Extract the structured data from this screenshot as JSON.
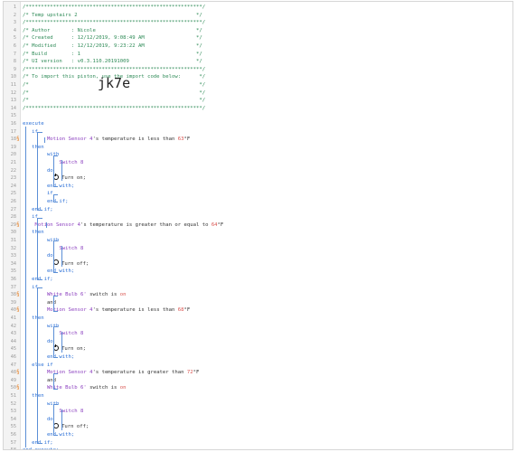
{
  "lines": [
    {
      "n": "1",
      "parts": [
        {
          "t": "/**********************************************************/",
          "c": "cm"
        }
      ]
    },
    {
      "n": "2",
      "parts": [
        {
          "t": "/* Temp upstairs 2                                       */",
          "c": "cm"
        }
      ]
    },
    {
      "n": "3",
      "parts": [
        {
          "t": "/**********************************************************/",
          "c": "cm"
        }
      ]
    },
    {
      "n": "4",
      "parts": [
        {
          "t": "/* Author       : Nicole                                 */",
          "c": "cm"
        }
      ]
    },
    {
      "n": "5",
      "parts": [
        {
          "t": "/* Created      : 12/12/2019, 9:08:49 AM                 */",
          "c": "cm"
        }
      ]
    },
    {
      "n": "6",
      "parts": [
        {
          "t": "/* Modified     : 12/12/2019, 9:23:22 AM                 */",
          "c": "cm"
        }
      ]
    },
    {
      "n": "7",
      "parts": [
        {
          "t": "/* Build        : 1                                      */",
          "c": "cm"
        }
      ]
    },
    {
      "n": "8",
      "parts": [
        {
          "t": "/* UI version   : v0.3.110.20191009                      */",
          "c": "cm"
        }
      ]
    },
    {
      "n": "9",
      "parts": [
        {
          "t": "/**********************************************************/",
          "c": "cm"
        }
      ]
    },
    {
      "n": "10",
      "parts": [
        {
          "t": "/* To import this piston, use the import code below:      */",
          "c": "cm"
        }
      ]
    },
    {
      "n": "11",
      "parts": [
        {
          "t": "/*                                                        */",
          "c": "cm"
        }
      ]
    },
    {
      "n": "12",
      "parts": [
        {
          "t": "/*                                                        */",
          "c": "cm"
        }
      ]
    },
    {
      "n": "13",
      "parts": [
        {
          "t": "/*                                                        */",
          "c": "cm"
        }
      ]
    },
    {
      "n": "14",
      "parts": [
        {
          "t": "/**********************************************************/",
          "c": "cm"
        }
      ]
    },
    {
      "n": "15",
      "parts": []
    },
    {
      "n": "16",
      "parts": [
        {
          "t": "execute",
          "c": "kw"
        }
      ]
    },
    {
      "n": "17",
      "parts": [
        {
          "t": "   if",
          "c": "kw"
        }
      ]
    },
    {
      "n": "18",
      "mark": true,
      "parts": [
        {
          "t": "        Motion Sensor 4",
          "c": "dev"
        },
        {
          "t": "'s temperature is less than ",
          "c": "txt"
        },
        {
          "t": "63",
          "c": "val"
        },
        {
          "t": "°F",
          "c": "txt"
        }
      ]
    },
    {
      "n": "19",
      "parts": [
        {
          "t": "   then",
          "c": "kw"
        }
      ]
    },
    {
      "n": "20",
      "parts": [
        {
          "t": "        with",
          "c": "kw"
        }
      ]
    },
    {
      "n": "21",
      "parts": [
        {
          "t": "            Switch 8",
          "c": "dev"
        }
      ]
    },
    {
      "n": "22",
      "parts": [
        {
          "t": "        do",
          "c": "kw"
        }
      ]
    },
    {
      "n": "23",
      "icon": "on",
      "parts": [
        {
          "t": "            Turn on;",
          "c": "txt"
        }
      ]
    },
    {
      "n": "24",
      "parts": [
        {
          "t": "        end with;",
          "c": "kw"
        }
      ]
    },
    {
      "n": "25",
      "parts": [
        {
          "t": "        if",
          "c": "kw"
        }
      ]
    },
    {
      "n": "26",
      "parts": [
        {
          "t": "        end if;",
          "c": "kw"
        }
      ]
    },
    {
      "n": "27",
      "parts": [
        {
          "t": "   end if;",
          "c": "kw"
        }
      ]
    },
    {
      "n": "28",
      "parts": [
        {
          "t": "   if",
          "c": "kw"
        }
      ]
    },
    {
      "n": "29",
      "mark": true,
      "parts": [
        {
          "t": "    Motion Sensor 4",
          "c": "dev"
        },
        {
          "t": "'s temperature is greater than or equal to ",
          "c": "txt"
        },
        {
          "t": "64",
          "c": "val"
        },
        {
          "t": "°F",
          "c": "txt"
        }
      ]
    },
    {
      "n": "30",
      "parts": [
        {
          "t": "   then",
          "c": "kw"
        }
      ]
    },
    {
      "n": "31",
      "parts": [
        {
          "t": "        with",
          "c": "kw"
        }
      ]
    },
    {
      "n": "32",
      "parts": [
        {
          "t": "            Switch 8",
          "c": "dev"
        }
      ]
    },
    {
      "n": "33",
      "parts": [
        {
          "t": "        do",
          "c": "kw"
        }
      ]
    },
    {
      "n": "34",
      "icon": "off",
      "parts": [
        {
          "t": "            Turn off;",
          "c": "txt"
        }
      ]
    },
    {
      "n": "35",
      "parts": [
        {
          "t": "        end with;",
          "c": "kw"
        }
      ]
    },
    {
      "n": "36",
      "parts": [
        {
          "t": "   end if;",
          "c": "kw"
        }
      ]
    },
    {
      "n": "37",
      "parts": [
        {
          "t": "   if",
          "c": "kw"
        }
      ]
    },
    {
      "n": "38",
      "mark": true,
      "parts": [
        {
          "t": "        White Bulb 6'",
          "c": "dev"
        },
        {
          "t": " switch is ",
          "c": "txt"
        },
        {
          "t": "on",
          "c": "val"
        }
      ]
    },
    {
      "n": "39",
      "parts": [
        {
          "t": "        and",
          "c": "txt"
        }
      ]
    },
    {
      "n": "40",
      "mark": true,
      "parts": [
        {
          "t": "        Motion Sensor 4",
          "c": "dev"
        },
        {
          "t": "'s temperature is less than ",
          "c": "txt"
        },
        {
          "t": "68",
          "c": "val"
        },
        {
          "t": "°F",
          "c": "txt"
        }
      ]
    },
    {
      "n": "41",
      "parts": [
        {
          "t": "   then",
          "c": "kw"
        }
      ]
    },
    {
      "n": "42",
      "parts": [
        {
          "t": "        with",
          "c": "kw"
        }
      ]
    },
    {
      "n": "43",
      "parts": [
        {
          "t": "            Switch 8",
          "c": "dev"
        }
      ]
    },
    {
      "n": "44",
      "parts": [
        {
          "t": "        do",
          "c": "kw"
        }
      ]
    },
    {
      "n": "45",
      "icon": "on",
      "parts": [
        {
          "t": "            Turn on;",
          "c": "txt"
        }
      ]
    },
    {
      "n": "46",
      "parts": [
        {
          "t": "        end with;",
          "c": "kw"
        }
      ]
    },
    {
      "n": "47",
      "parts": [
        {
          "t": "   else if",
          "c": "kw"
        }
      ]
    },
    {
      "n": "48",
      "mark": true,
      "parts": [
        {
          "t": "        Motion Sensor 4",
          "c": "dev"
        },
        {
          "t": "'s temperature is greater than ",
          "c": "txt"
        },
        {
          "t": "72",
          "c": "val"
        },
        {
          "t": "°F",
          "c": "txt"
        }
      ]
    },
    {
      "n": "49",
      "parts": [
        {
          "t": "        and",
          "c": "txt"
        }
      ]
    },
    {
      "n": "50",
      "mark": true,
      "parts": [
        {
          "t": "        White Bulb 6'",
          "c": "dev"
        },
        {
          "t": " switch is ",
          "c": "txt"
        },
        {
          "t": "on",
          "c": "val"
        }
      ]
    },
    {
      "n": "51",
      "parts": [
        {
          "t": "   then",
          "c": "kw"
        }
      ]
    },
    {
      "n": "52",
      "parts": [
        {
          "t": "        with",
          "c": "kw"
        }
      ]
    },
    {
      "n": "53",
      "parts": [
        {
          "t": "            Switch 8",
          "c": "dev"
        }
      ]
    },
    {
      "n": "54",
      "parts": [
        {
          "t": "        do",
          "c": "kw"
        }
      ]
    },
    {
      "n": "55",
      "icon": "off",
      "parts": [
        {
          "t": "            Turn off;",
          "c": "txt"
        }
      ]
    },
    {
      "n": "56",
      "parts": [
        {
          "t": "        end with;",
          "c": "kw"
        }
      ]
    },
    {
      "n": "57",
      "parts": [
        {
          "t": "   end if;",
          "c": "kw"
        }
      ]
    },
    {
      "n": "58",
      "parts": [
        {
          "t": "end execute;",
          "c": "kw"
        }
      ]
    }
  ],
  "import_code": "jk7e",
  "colors": {
    "comment": "#2e8b57",
    "keyword": "#2a6fd6",
    "device": "#8b3fbf",
    "value": "#d9534f",
    "marker": "#e67e22",
    "bracket": "#5b8fd6"
  },
  "icons": {
    "on": "power-on-icon",
    "off": "power-off-icon",
    "mark": "condition-marker-icon"
  }
}
